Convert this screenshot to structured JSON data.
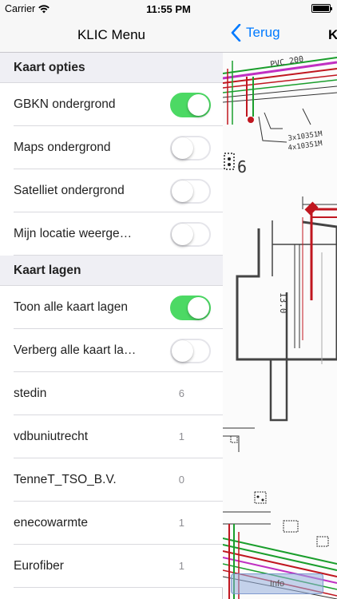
{
  "status_bar": {
    "carrier": "Carrier",
    "time": "11:55 PM",
    "wifi_icon": "wifi-icon",
    "battery_icon": "battery-icon"
  },
  "menu": {
    "title": "KLIC Menu",
    "sections": [
      {
        "header": "Kaart opties",
        "rows": [
          {
            "label": "GBKN ondergrond",
            "toggle": true
          },
          {
            "label": "Maps ondergrond",
            "toggle": false
          },
          {
            "label": "Satelliet ondergrond",
            "toggle": false
          },
          {
            "label": "Mijn locatie weerge…",
            "toggle": false
          }
        ]
      },
      {
        "header": "Kaart lagen",
        "rows": [
          {
            "label": "Toon alle kaart lagen",
            "toggle": true
          },
          {
            "label": "Verberg alle kaart la…",
            "toggle": false
          },
          {
            "label": "stedin",
            "count": "6"
          },
          {
            "label": "vdbuniutrecht",
            "count": "1"
          },
          {
            "label": "TenneT_TSO_B.V.",
            "count": "0"
          },
          {
            "label": "enecowarmte",
            "count": "1"
          },
          {
            "label": "Eurofiber",
            "count": "1"
          }
        ]
      }
    ]
  },
  "map": {
    "back_label": "Terug",
    "back_icon": "chevron-left-icon",
    "title": "K",
    "info_label": "Info",
    "drawing_labels": [
      "PVC 200",
      "3x10351M",
      "4x10351M",
      "6",
      "13.0"
    ]
  },
  "colors": {
    "accent": "#007aff",
    "toggle_on": "#4cd964",
    "section_bg": "#efeff4",
    "cable_red": "#c0161f",
    "cable_green": "#1a9e2c",
    "cable_magenta": "#c02fc2"
  }
}
